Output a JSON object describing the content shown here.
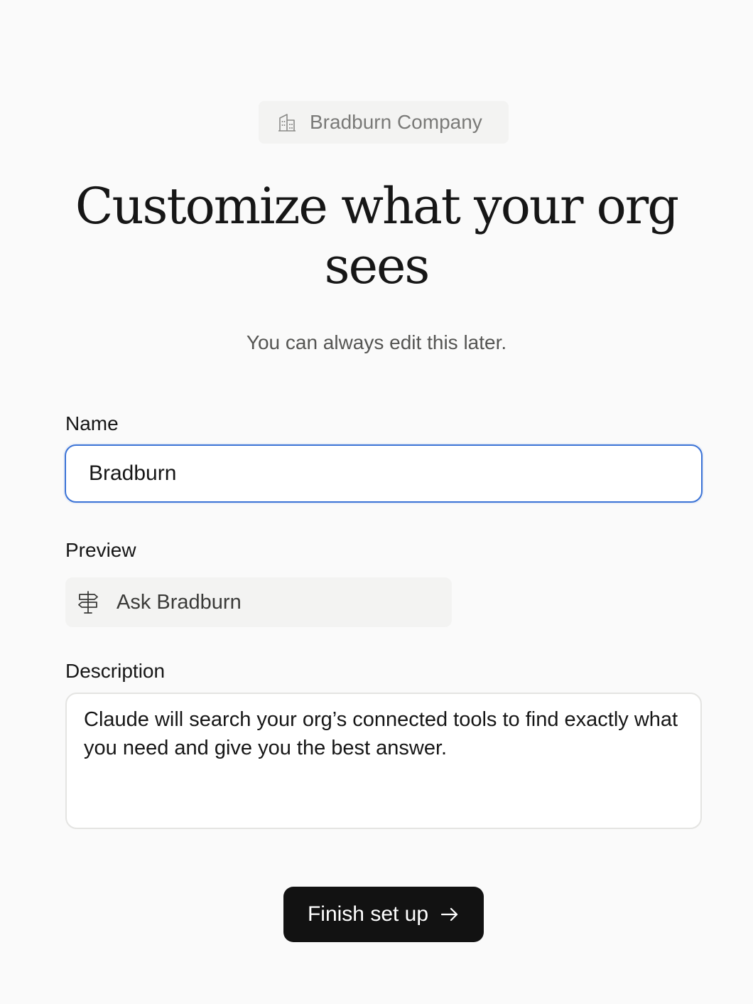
{
  "org": {
    "icon": "building-icon",
    "name": "Bradburn Company"
  },
  "header": {
    "title": "Customize what your org sees",
    "subtitle": "You can always edit this later."
  },
  "form": {
    "name_label": "Name",
    "name_value": "Bradburn",
    "preview_label": "Preview",
    "preview_icon": "signpost-icon",
    "preview_text": "Ask Bradburn",
    "description_label": "Description",
    "description_value": "Claude will search your org’s connected tools to find exactly what you need and give you the best answer."
  },
  "actions": {
    "finish_label": "Finish set up",
    "finish_icon": "arrow-right-icon"
  },
  "colors": {
    "background": "#fafafa",
    "focus_border": "#3b73d6",
    "button": "#121212"
  }
}
